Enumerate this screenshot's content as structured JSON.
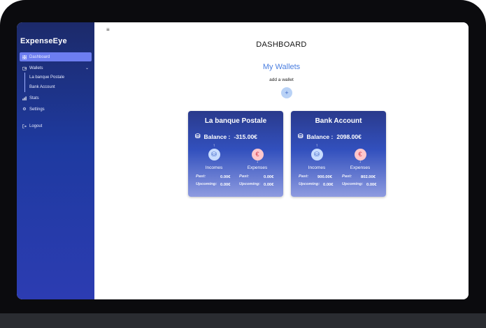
{
  "app": {
    "brand": "ExpenseEye"
  },
  "sidebar": {
    "items": [
      {
        "label": "Dashboard",
        "icon": "grid-icon"
      },
      {
        "label": "Wallets",
        "icon": "wallet-icon"
      },
      {
        "label": "Stats",
        "icon": "chart-icon"
      },
      {
        "label": "Settings",
        "icon": "gear-icon"
      },
      {
        "label": "Logout",
        "icon": "logout-icon"
      }
    ],
    "subitems": [
      "La banque Postale",
      "Bank Account"
    ]
  },
  "main": {
    "title": "DASHBOARD",
    "wallets_title": "My Wallets",
    "add_label": "add a wallet",
    "add_button": "+"
  },
  "wallets": [
    {
      "name": "La banque Postale",
      "balance_label": "Balance :",
      "balance": "-315.00€",
      "incomes_label": "Incomes",
      "expenses_label": "Expenses",
      "income_past_label": "Past:",
      "income_past": "0.00€",
      "income_upcoming_label": "Upcoming:",
      "income_upcoming": "0.00€",
      "expense_past_label": "Past:",
      "expense_past": "0.00€",
      "expense_upcoming_label": "Upcoming:",
      "expense_upcoming": "0.00€"
    },
    {
      "name": "Bank Account",
      "balance_label": "Balance :",
      "balance": "2098.00€",
      "incomes_label": "Incomes",
      "expenses_label": "Expenses",
      "income_past_label": "Past:",
      "income_past": "900.00€",
      "income_upcoming_label": "Upcoming:",
      "income_upcoming": "0.00€",
      "expense_past_label": "Past:",
      "expense_past": "802.00€",
      "expense_upcoming_label": "Upcoming:",
      "expense_upcoming": "0.00€"
    }
  ],
  "colors": {
    "accent": "#6d7ef0",
    "wallet_title": "#4a7ee0",
    "income": "#c8dcff",
    "expense": "#ffc7cc"
  }
}
